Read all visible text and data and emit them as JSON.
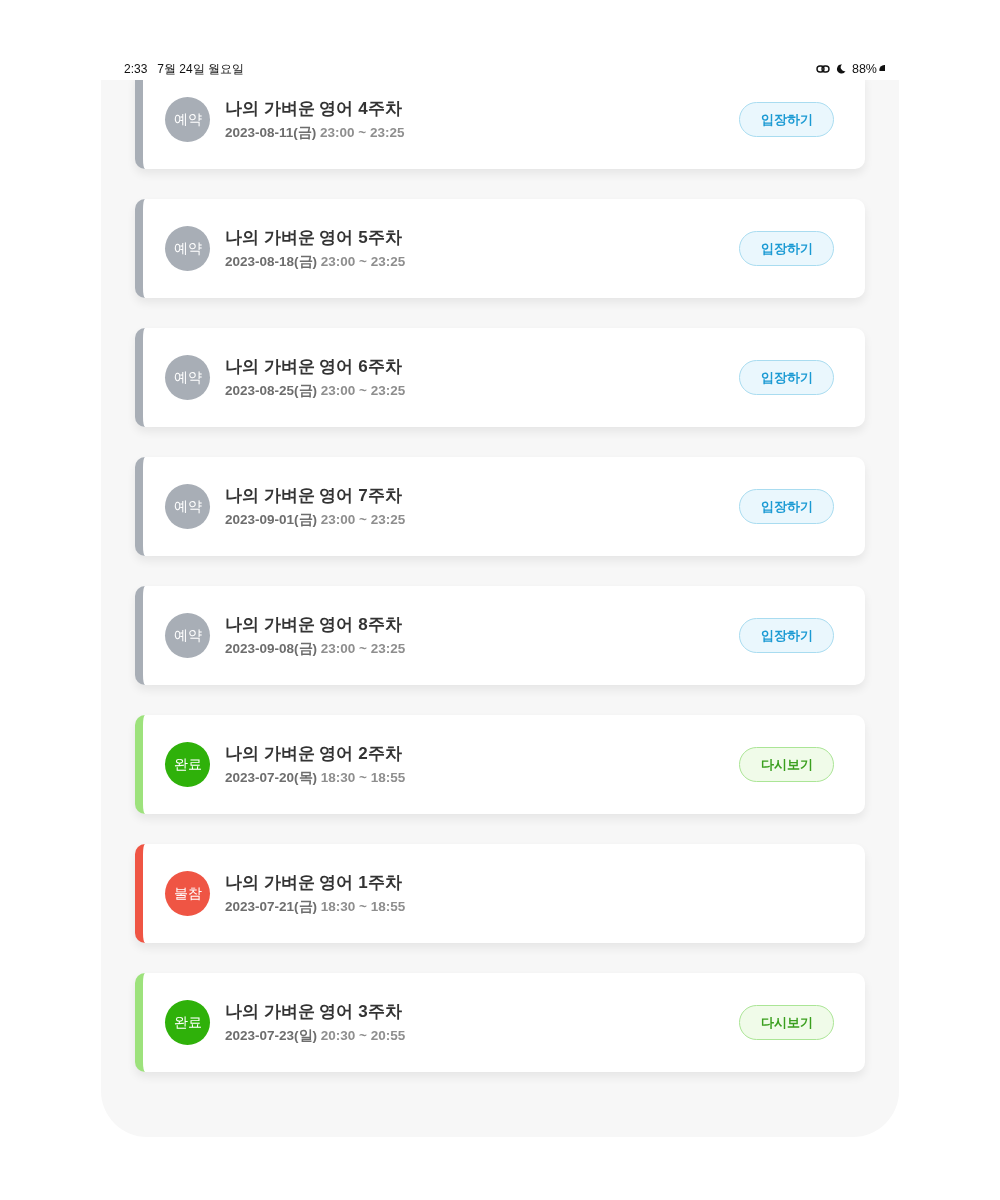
{
  "status_bar": {
    "time": "2:33",
    "date": "7월 24일 월요일",
    "battery": "88%"
  },
  "sessions": [
    {
      "kind": "reserved",
      "status": "예약",
      "title": "나의 가벼운 영어 4주차",
      "date": "2023-08-11(금)",
      "time": "23:00 ~ 23:25",
      "button": {
        "kind": "enter",
        "label": "입장하기"
      }
    },
    {
      "kind": "reserved",
      "status": "예약",
      "title": "나의 가벼운 영어 5주차",
      "date": "2023-08-18(금)",
      "time": "23:00 ~ 23:25",
      "button": {
        "kind": "enter",
        "label": "입장하기"
      }
    },
    {
      "kind": "reserved",
      "status": "예약",
      "title": "나의 가벼운 영어 6주차",
      "date": "2023-08-25(금)",
      "time": "23:00 ~ 23:25",
      "button": {
        "kind": "enter",
        "label": "입장하기"
      }
    },
    {
      "kind": "reserved",
      "status": "예약",
      "title": "나의 가벼운 영어 7주차",
      "date": "2023-09-01(금)",
      "time": "23:00 ~ 23:25",
      "button": {
        "kind": "enter",
        "label": "입장하기"
      }
    },
    {
      "kind": "reserved",
      "status": "예약",
      "title": "나의 가벼운 영어 8주차",
      "date": "2023-09-08(금)",
      "time": "23:00 ~ 23:25",
      "button": {
        "kind": "enter",
        "label": "입장하기"
      }
    },
    {
      "kind": "completed",
      "status": "완료",
      "title": "나의 가벼운 영어 2주차",
      "date": "2023-07-20(목)",
      "time": "18:30 ~ 18:55",
      "button": {
        "kind": "replay",
        "label": "다시보기"
      }
    },
    {
      "kind": "absent",
      "status": "불참",
      "title": "나의 가벼운 영어 1주차",
      "date": "2023-07-21(금)",
      "time": "18:30 ~ 18:55"
    },
    {
      "kind": "completed",
      "status": "완료",
      "title": "나의 가벼운 영어 3주차",
      "date": "2023-07-23(일)",
      "time": "20:30 ~ 20:55",
      "button": {
        "kind": "replay",
        "label": "다시보기"
      }
    }
  ]
}
